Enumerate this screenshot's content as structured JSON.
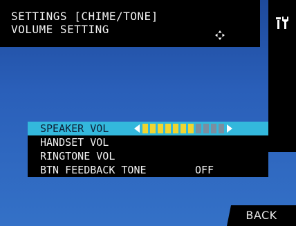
{
  "header": {
    "title_line1": "SETTINGS [CHIME/TONE]",
    "title_line2": "VOLUME SETTING",
    "nav_icon": "four-way-arrows-icon"
  },
  "side_panel": {
    "icon": "tools-icon"
  },
  "menu": {
    "items": [
      {
        "label": "SPEAKER VOL",
        "selected": true
      },
      {
        "label": "HANDSET VOL"
      },
      {
        "label": "RINGTONE VOL"
      },
      {
        "label": "BTN FEEDBACK TONE",
        "value": "OFF"
      }
    ],
    "speaker_volume": {
      "level": 7,
      "max": 11
    }
  },
  "footer": {
    "back_label": "BACK"
  },
  "colors": {
    "background": "#2a5fb9",
    "highlight": "#33b8dc",
    "slider_on": "#f0d530",
    "slider_off": "#7b8ea0"
  }
}
